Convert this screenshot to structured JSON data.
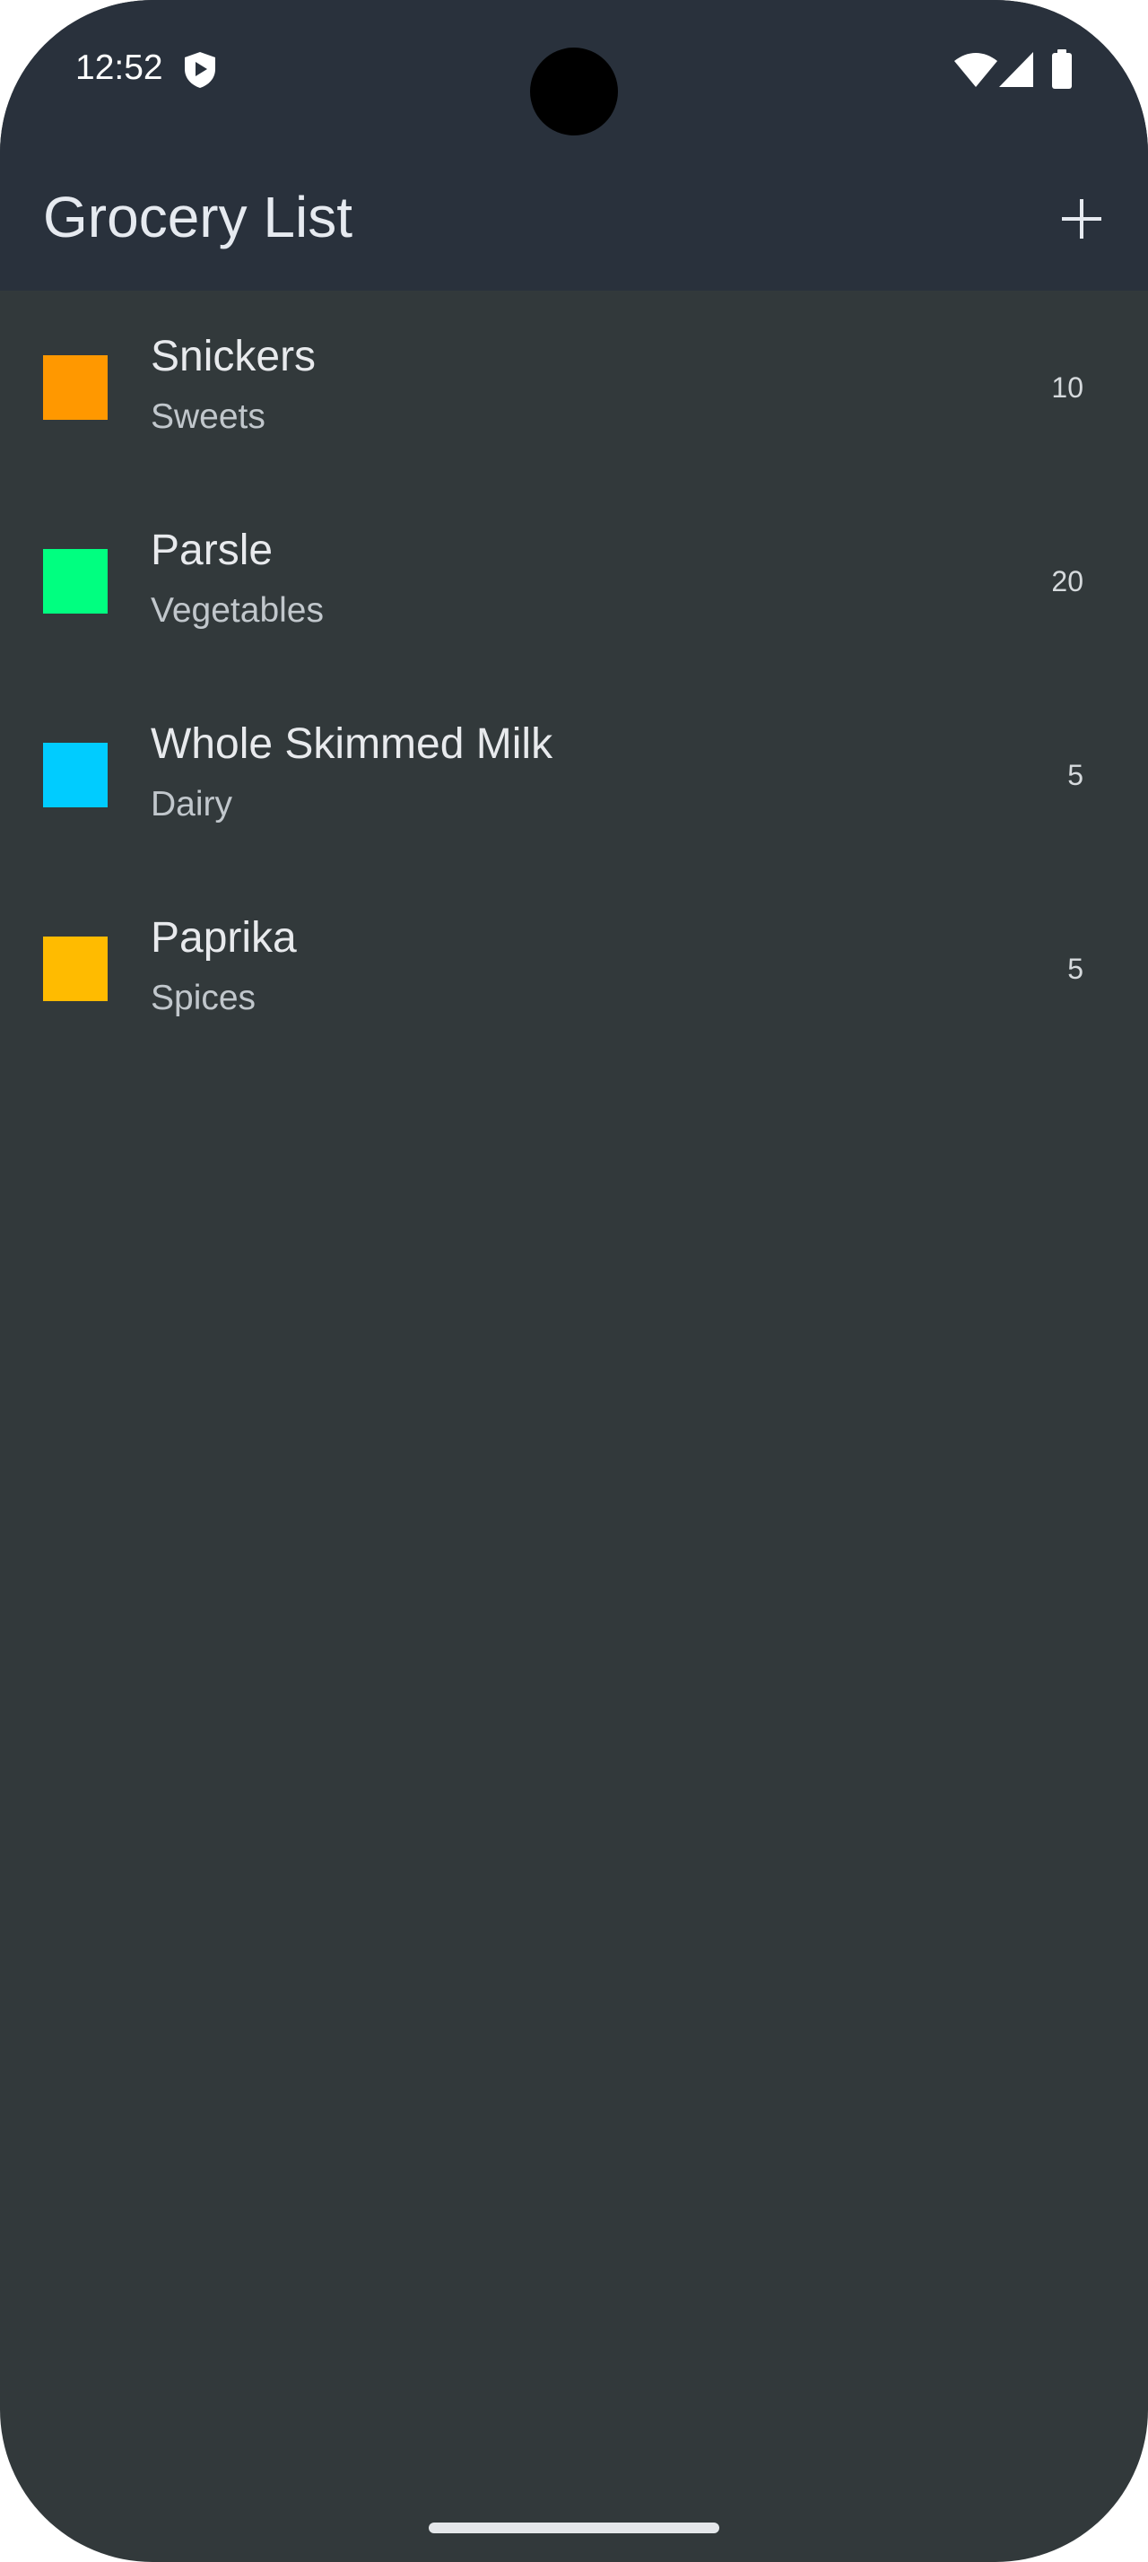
{
  "status_bar": {
    "time": "12:52",
    "icons": [
      "shield-icon",
      "wifi-icon",
      "signal-icon",
      "battery-icon"
    ]
  },
  "app_bar": {
    "title": "Grocery List",
    "add_icon": "plus-icon"
  },
  "items": [
    {
      "name": "Snickers",
      "category": "Sweets",
      "quantity": "10",
      "color": "#ff9800"
    },
    {
      "name": "Parsle",
      "category": "Vegetables",
      "quantity": "20",
      "color": "#00ff80"
    },
    {
      "name": "Whole Skimmed Milk",
      "category": "Dairy",
      "quantity": "5",
      "color": "#00ccff"
    },
    {
      "name": "Paprika",
      "category": "Spices",
      "quantity": "5",
      "color": "#ffbb00"
    }
  ],
  "colors": {
    "app_bar": "#29313c",
    "background": "#32393b"
  }
}
